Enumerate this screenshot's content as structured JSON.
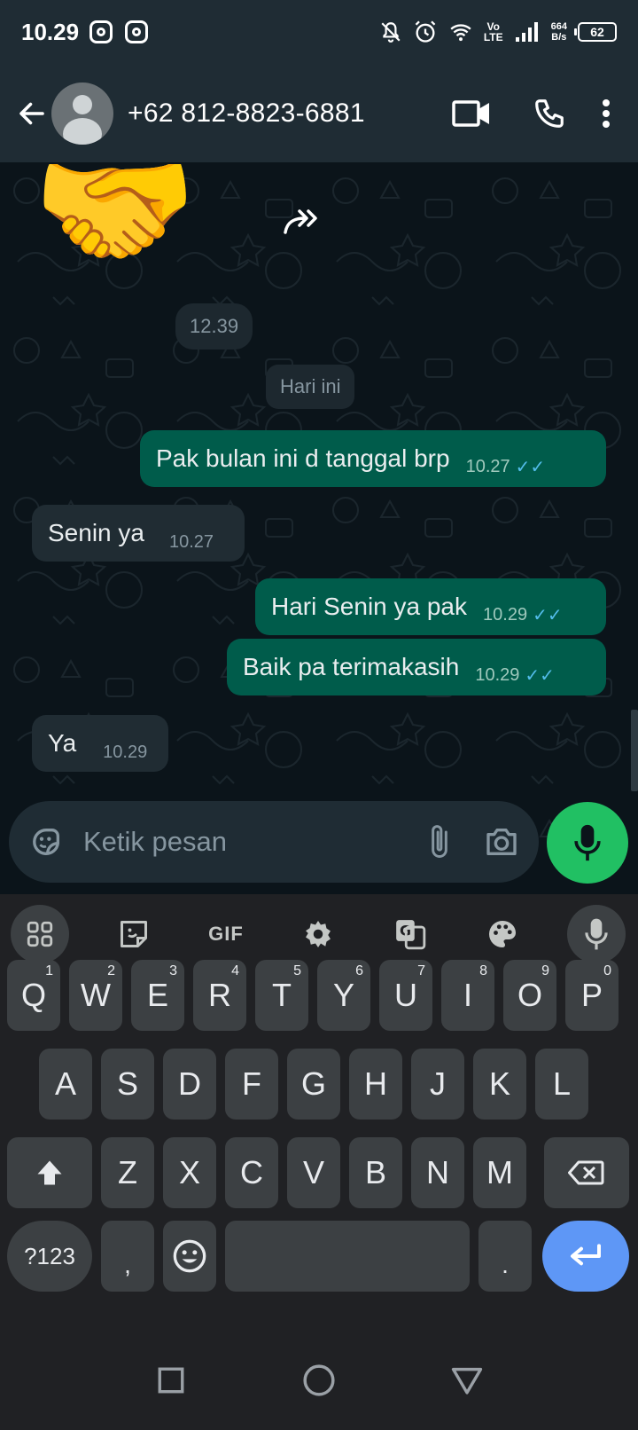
{
  "status_bar": {
    "time": "10.29",
    "net_speed_value": "664",
    "net_speed_unit": "B/s",
    "volte_top": "Vo",
    "volte_bottom": "LTE",
    "battery": "62"
  },
  "header": {
    "contact_name": "+62 812-8823-6881",
    "icons": [
      "back-arrow-icon",
      "video-call-icon",
      "phone-icon",
      "more-vert-icon"
    ]
  },
  "chat": {
    "sticker": "🤝",
    "sticker_time": "12.39",
    "date_divider": "Hari ini",
    "messages": [
      {
        "direction": "out",
        "text": "Pak bulan ini d tanggal brp",
        "time": "10.27",
        "status": "read"
      },
      {
        "direction": "in",
        "text": "Senin ya",
        "time": "10.27"
      },
      {
        "direction": "out",
        "text": "Hari Senin ya pak",
        "time": "10.29",
        "status": "read"
      },
      {
        "direction": "out",
        "text": "Baik pa terimakasih",
        "time": "10.29",
        "status": "read"
      },
      {
        "direction": "in",
        "text": "Ya",
        "time": "10.29"
      }
    ],
    "read_tick": "✓✓"
  },
  "composer": {
    "placeholder": "Ketik pesan"
  },
  "keyboard": {
    "toolbar": {
      "gif_label": "GIF"
    },
    "row1": [
      {
        "label": "Q",
        "hint": "1"
      },
      {
        "label": "W",
        "hint": "2"
      },
      {
        "label": "E",
        "hint": "3"
      },
      {
        "label": "R",
        "hint": "4"
      },
      {
        "label": "T",
        "hint": "5"
      },
      {
        "label": "Y",
        "hint": "6"
      },
      {
        "label": "U",
        "hint": "7"
      },
      {
        "label": "I",
        "hint": "8"
      },
      {
        "label": "O",
        "hint": "9"
      },
      {
        "label": "P",
        "hint": "0"
      }
    ],
    "row2": [
      "A",
      "S",
      "D",
      "F",
      "G",
      "H",
      "J",
      "K",
      "L"
    ],
    "row3": [
      "Z",
      "X",
      "C",
      "V",
      "B",
      "N",
      "M"
    ],
    "symbols_key": "?123",
    "comma_key": ",",
    "period_key": "."
  },
  "colors": {
    "outgoing_bubble": "#005c4b",
    "incoming_bubble": "#202c33",
    "mic_button": "#21c063",
    "enter_key": "#5e97f6",
    "read_tick": "#53bdeb"
  }
}
